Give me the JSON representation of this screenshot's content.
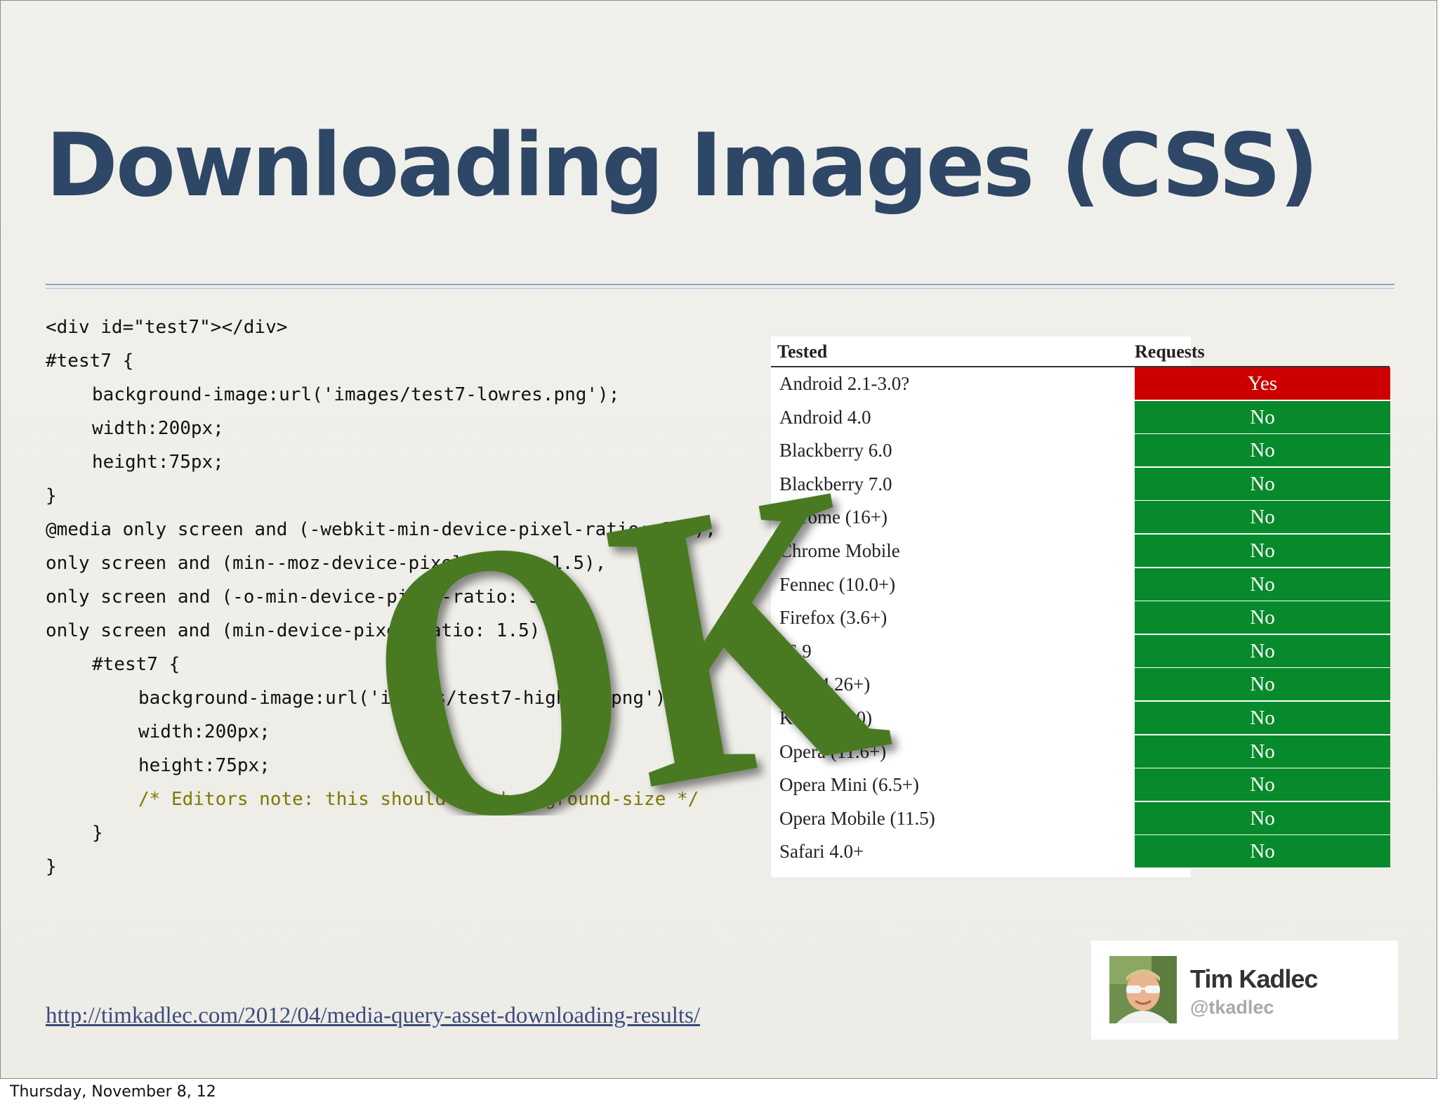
{
  "slide": {
    "title": "Downloading Images (CSS)",
    "code_lines": [
      {
        "text": "<div id=\"test7\"></div>",
        "indent": 0
      },
      {
        "text": "#test7 {",
        "indent": 0
      },
      {
        "text": "background-image:url('images/test7-lowres.png');",
        "indent": 1
      },
      {
        "text": "width:200px;",
        "indent": 1
      },
      {
        "text": "height:75px;",
        "indent": 1
      },
      {
        "text": "}",
        "indent": 0
      },
      {
        "text": "@media only screen and (-webkit-min-device-pixel-ratio: 1.5),",
        "indent": 0
      },
      {
        "text": "only screen and (min--moz-device-pixel-ratio: 1.5),",
        "indent": 0
      },
      {
        "text": "only screen and (-o-min-device-pixel-ratio: 3/2),",
        "indent": 0
      },
      {
        "text": "only screen and (min-device-pixel-ratio: 1.5) {",
        "indent": 0
      },
      {
        "text": "#test7 {",
        "indent": 1
      },
      {
        "text": "background-image:url('images/test7-highres.png');",
        "indent": 2
      },
      {
        "text": "width:200px;",
        "indent": 2
      },
      {
        "text": "height:75px;",
        "indent": 2
      },
      {
        "text": "/* Editors note: this should use background-size */",
        "indent": 2,
        "comment": true
      },
      {
        "text": "}",
        "indent": 1
      },
      {
        "text": "}",
        "indent": 0
      }
    ],
    "table": {
      "headers": [
        "Tested",
        "Requests Both"
      ],
      "rows": [
        {
          "name": "Android 2.1-3.0?",
          "value": "Yes"
        },
        {
          "name": "Android 4.0",
          "value": "No"
        },
        {
          "name": "Blackberry 6.0",
          "value": "No"
        },
        {
          "name": "Blackberry 7.0",
          "value": "No"
        },
        {
          "name": "Chrome (16+)",
          "value": "No"
        },
        {
          "name": "Chrome Mobile",
          "value": "No"
        },
        {
          "name": "Fennec (10.0+)",
          "value": "No"
        },
        {
          "name": "Firefox (3.6+)",
          "value": "No"
        },
        {
          "name": "IE 9",
          "value": "No"
        },
        {
          "name": "iOS (4.26+)",
          "value": "No"
        },
        {
          "name": "Kindle (3.0)",
          "value": "No"
        },
        {
          "name": "Opera (11.6+)",
          "value": "No"
        },
        {
          "name": "Opera Mini (6.5+)",
          "value": "No"
        },
        {
          "name": "Opera Mobile (11.5)",
          "value": "No"
        },
        {
          "name": "Safari 4.0+",
          "value": "No"
        }
      ]
    },
    "stamp_text": "OK",
    "link_text": "http://timkadlec.com/2012/04/media-query-asset-downloading-results/",
    "profile": {
      "name": "Tim Kadlec",
      "handle": "@tkadlec"
    }
  },
  "footer": {
    "date": "Thursday, November 8, 12"
  },
  "colors": {
    "title": "#2f4766",
    "yes_cell": "#cc0000",
    "no_cell": "#078a2b",
    "stamp": "#4a7a22",
    "comment": "#7a7a00",
    "link": "#3b4c7c"
  },
  "icons": {
    "avatar": "profile-photo-avatar"
  }
}
